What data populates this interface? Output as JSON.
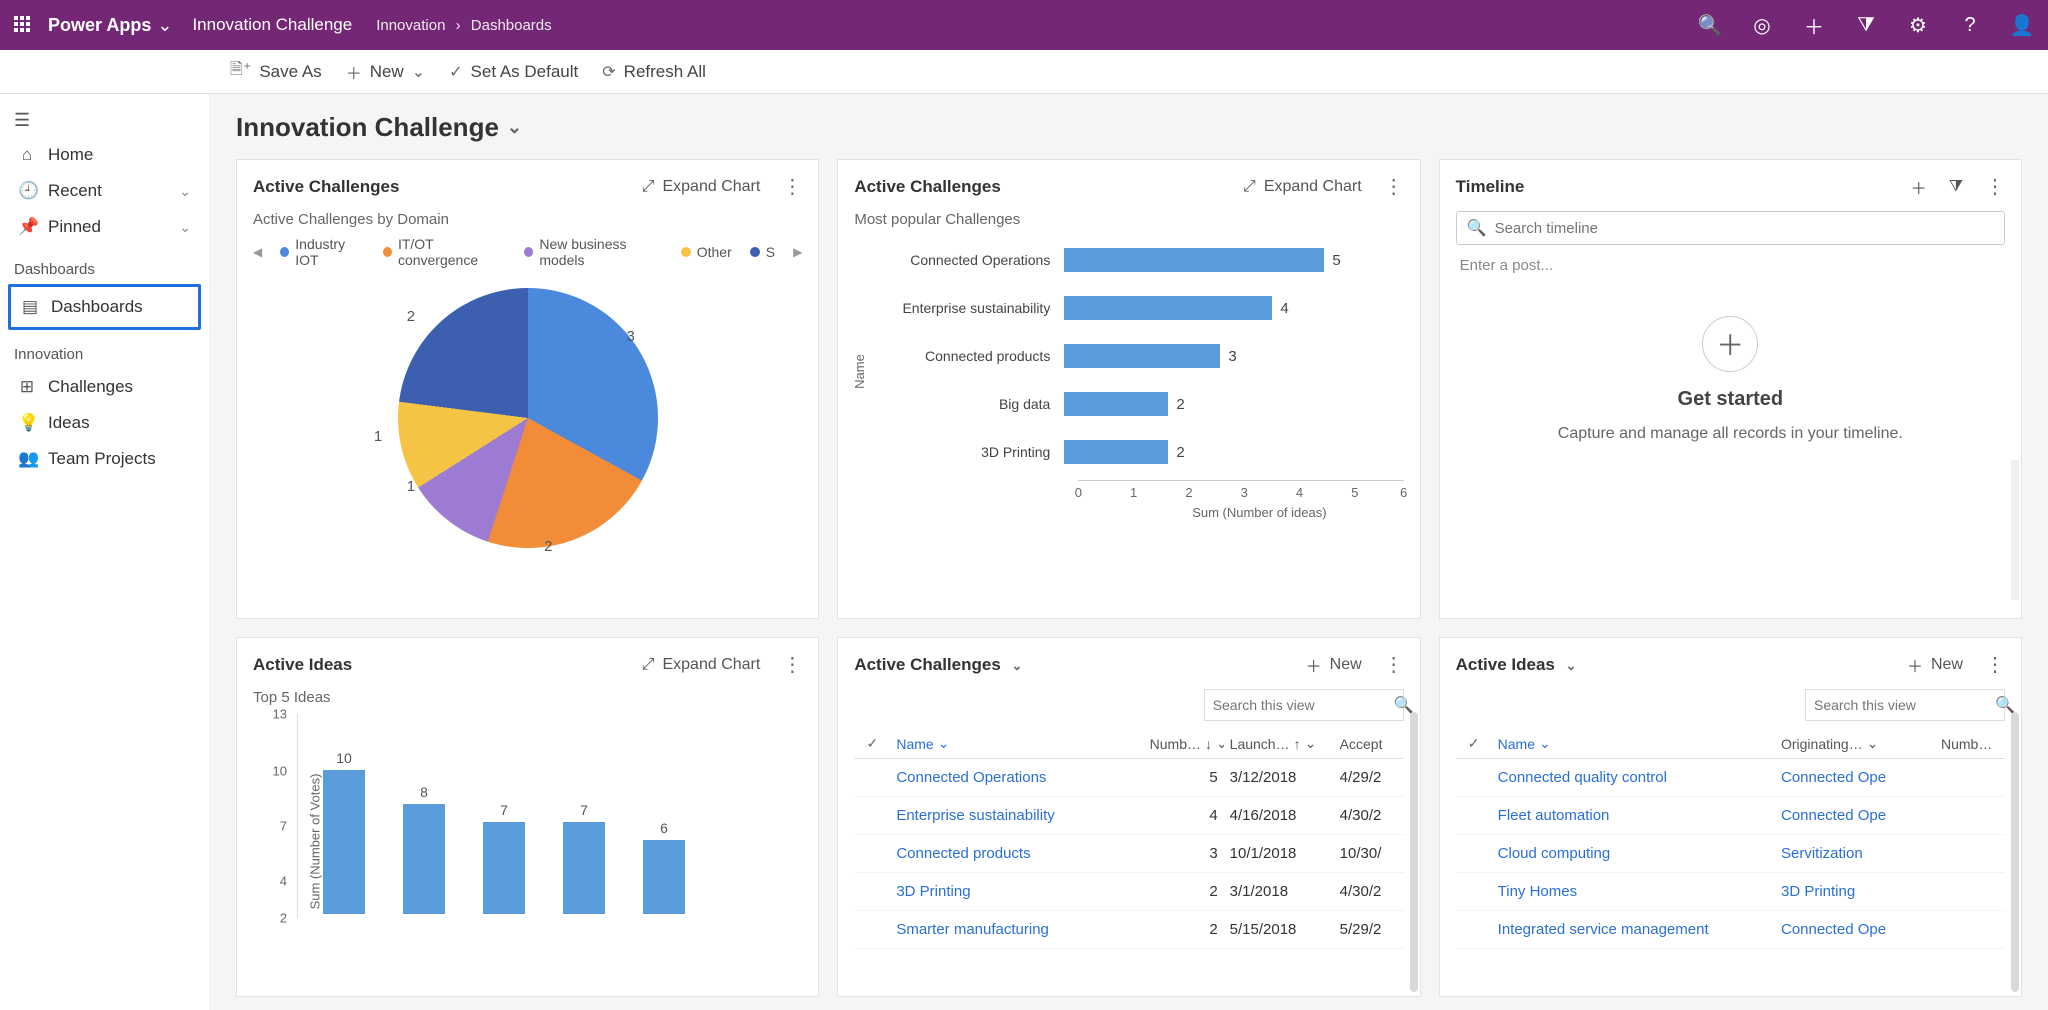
{
  "header": {
    "brand": "Power Apps",
    "environment": "Innovation Challenge",
    "breadcrumb": [
      "Innovation",
      "Dashboards"
    ]
  },
  "cmdbar": {
    "save_as": "Save As",
    "new": "New",
    "set_as_default": "Set As Default",
    "refresh_all": "Refresh All"
  },
  "leftnav": {
    "home": "Home",
    "recent": "Recent",
    "pinned": "Pinned",
    "sect_dashboards": "Dashboards",
    "dashboards": "Dashboards",
    "sect_innovation": "Innovation",
    "challenges": "Challenges",
    "ideas": "Ideas",
    "team_projects": "Team Projects"
  },
  "page": {
    "title": "Innovation Challenge"
  },
  "common": {
    "expand_chart": "Expand Chart",
    "new": "New",
    "search_view_ph": "Search this view"
  },
  "cards": {
    "pie": {
      "title": "Active Challenges",
      "subtitle": "Active Challenges by Domain",
      "legend": [
        "Industry IOT",
        "IT/OT convergence",
        "New business models",
        "Other",
        "S"
      ]
    },
    "hbar": {
      "title": "Active Challenges",
      "subtitle": "Most popular Challenges",
      "y_axis": "Name",
      "x_axis": "Sum (Number of ideas)"
    },
    "timeline": {
      "title": "Timeline",
      "search_ph": "Search timeline",
      "post_ph": "Enter a post...",
      "get_started": "Get started",
      "get_started_sub": "Capture and manage all records in your timeline."
    },
    "vbar": {
      "title": "Active Ideas",
      "subtitle": "Top 5 Ideas",
      "y_axis": "Sum (Number of Votes)"
    },
    "table_challenges": {
      "title": "Active Challenges",
      "cols": {
        "name": "Name",
        "numb": "Numb…",
        "launch": "Launch…",
        "accept": "Accept"
      }
    },
    "table_ideas": {
      "title": "Active Ideas",
      "cols": {
        "name": "Name",
        "orig": "Originating…",
        "numb": "Numb…"
      }
    }
  },
  "chart_data": [
    {
      "id": "active_challenges_by_domain",
      "type": "pie",
      "title": "Active Challenges by Domain",
      "categories": [
        "Industry IOT",
        "IT/OT convergence",
        "New business models",
        "Other",
        "S"
      ],
      "values": [
        3,
        2,
        1,
        1,
        2
      ],
      "colors": [
        "#4a89dc",
        "#f28c38",
        "#9d7bd3",
        "#f6c445",
        "#3c5fb0"
      ]
    },
    {
      "id": "most_popular_challenges",
      "type": "bar",
      "orientation": "horizontal",
      "title": "Most popular Challenges",
      "xlabel": "Sum (Number of ideas)",
      "ylabel": "Name",
      "xlim": [
        0,
        6
      ],
      "categories": [
        "Connected Operations",
        "Enterprise sustainability",
        "Connected products",
        "Big data",
        "3D Printing"
      ],
      "values": [
        5,
        4,
        3,
        2,
        2
      ]
    },
    {
      "id": "top_5_ideas",
      "type": "bar",
      "orientation": "vertical",
      "title": "Top 5 Ideas",
      "ylabel": "Sum (Number of Votes)",
      "ylim": [
        2,
        13
      ],
      "categories": [
        "",
        "",
        "",
        "",
        ""
      ],
      "values": [
        10,
        8,
        7,
        7,
        6
      ]
    }
  ],
  "tables": {
    "challenges": [
      {
        "name": "Connected Operations",
        "num": 5,
        "launch": "3/12/2018",
        "accept": "4/29/2"
      },
      {
        "name": "Enterprise sustainability",
        "num": 4,
        "launch": "4/16/2018",
        "accept": "4/30/2"
      },
      {
        "name": "Connected products",
        "num": 3,
        "launch": "10/1/2018",
        "accept": "10/30/"
      },
      {
        "name": "3D Printing",
        "num": 2,
        "launch": "3/1/2018",
        "accept": "4/30/2"
      },
      {
        "name": "Smarter manufacturing",
        "num": 2,
        "launch": "5/15/2018",
        "accept": "5/29/2"
      }
    ],
    "ideas": [
      {
        "name": "Connected quality control",
        "orig": "Connected Ope"
      },
      {
        "name": "Fleet automation",
        "orig": "Connected Ope"
      },
      {
        "name": "Cloud computing",
        "orig": "Servitization"
      },
      {
        "name": "Tiny Homes",
        "orig": "3D Printing"
      },
      {
        "name": "Integrated service management",
        "orig": "Connected Ope"
      }
    ]
  }
}
